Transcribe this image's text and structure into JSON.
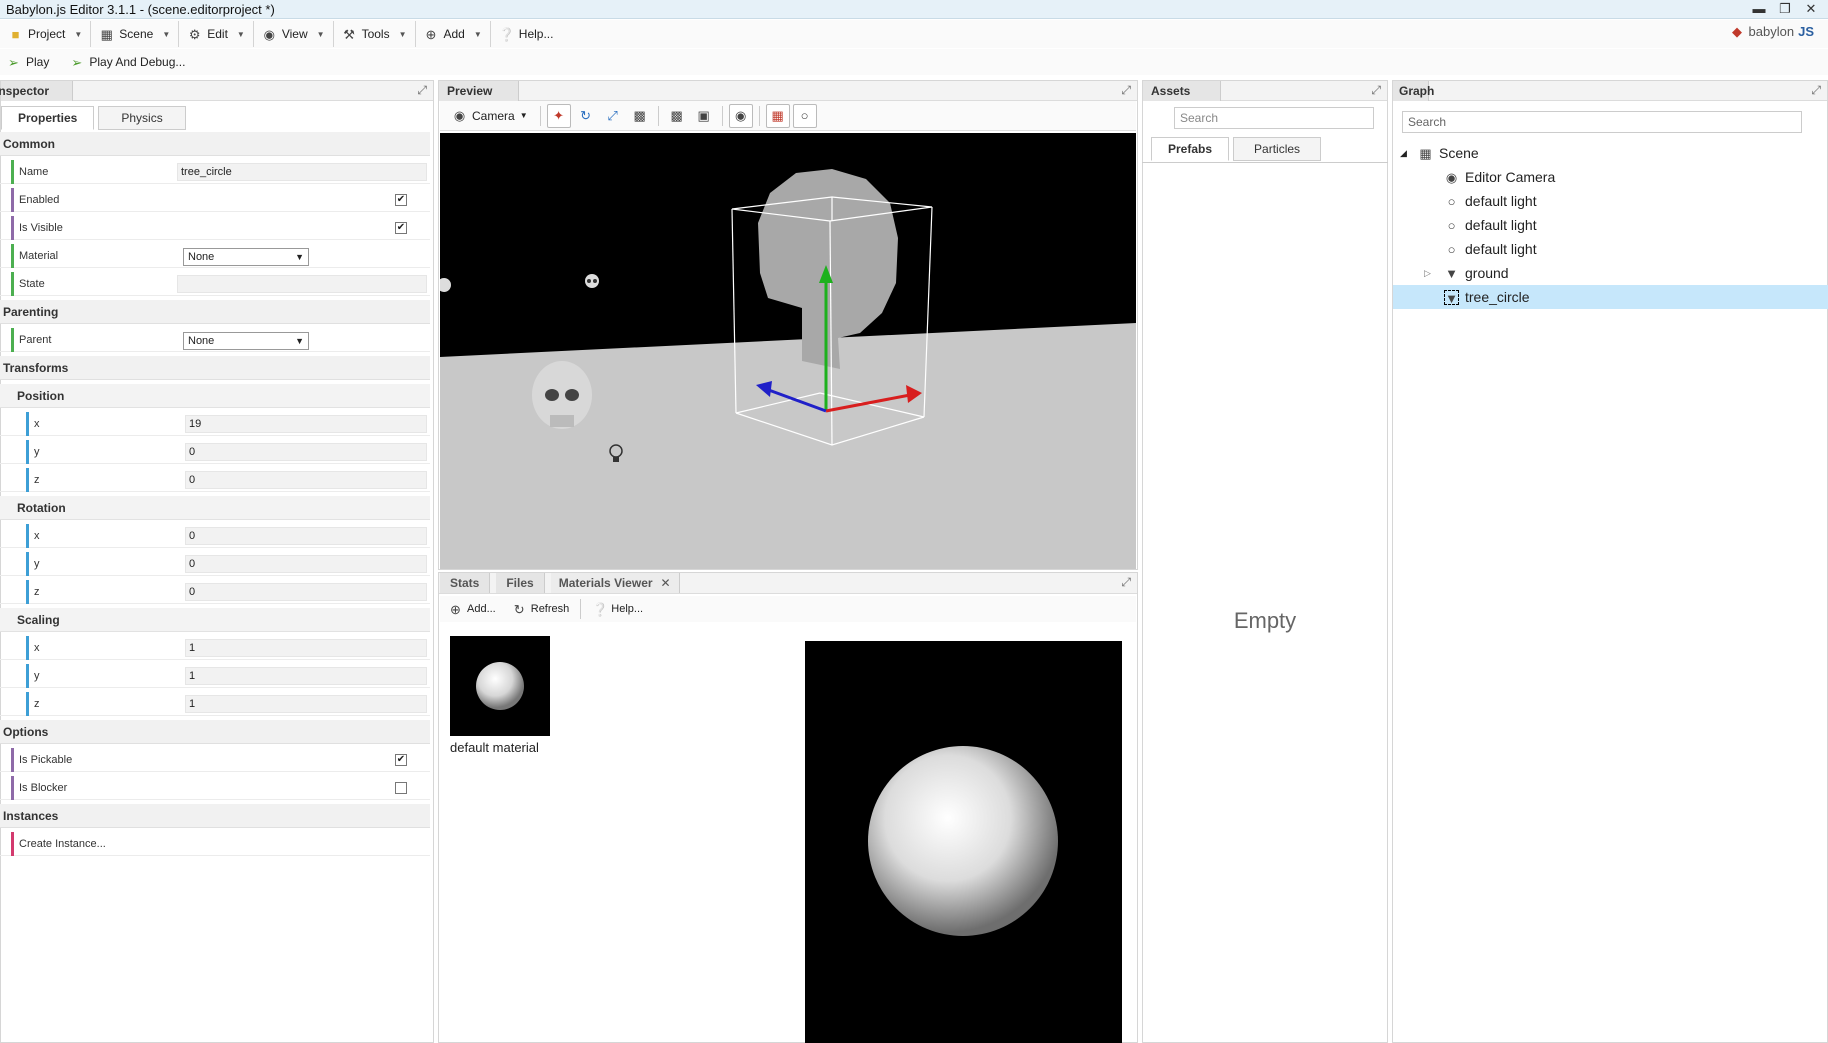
{
  "window": {
    "title": "Babylon.js Editor 3.1.1 - (scene.editorproject *)"
  },
  "menu": {
    "project": "Project",
    "scene": "Scene",
    "edit": "Edit",
    "view": "View",
    "tools": "Tools",
    "add": "Add",
    "help": "Help..."
  },
  "logo": {
    "prefix": "babylon",
    "suffix": "JS"
  },
  "playbar": {
    "play": "Play",
    "play_debug": "Play And Debug..."
  },
  "inspector": {
    "title": "Inspector",
    "tabs": [
      "Properties",
      "Physics"
    ],
    "sections": {
      "common": "Common",
      "parenting": "Parenting",
      "transforms": "Transforms",
      "position": "Position",
      "rotation": "Rotation",
      "scaling": "Scaling",
      "options": "Options",
      "instances": "Instances"
    },
    "labels": {
      "name": "Name",
      "enabled": "Enabled",
      "is_visible": "Is Visible",
      "material": "Material",
      "state": "State",
      "parent": "Parent",
      "x": "x",
      "y": "y",
      "z": "z",
      "is_pickable": "Is Pickable",
      "is_blocker": "Is Blocker",
      "create_instance": "Create Instance..."
    },
    "values": {
      "name": "tree_circle",
      "enabled": true,
      "is_visible": true,
      "material": "None",
      "state": "",
      "parent": "None",
      "position": [
        "19",
        "0",
        "0"
      ],
      "rotation": [
        "0",
        "0",
        "0"
      ],
      "scaling": [
        "1",
        "1",
        "1"
      ],
      "is_pickable": true,
      "is_blocker": false
    }
  },
  "preview": {
    "title": "Preview",
    "camera_label": "Camera"
  },
  "bottom": {
    "tabs": [
      "Stats",
      "Files",
      "Materials Viewer"
    ],
    "toolbar": {
      "add": "Add...",
      "refresh": "Refresh",
      "help": "Help..."
    },
    "material_name": "default material"
  },
  "assets": {
    "title": "Assets",
    "search_placeholder": "Search",
    "tabs": [
      "Prefabs",
      "Particles"
    ],
    "empty_text": "Empty"
  },
  "graph": {
    "title": "Graph",
    "search_placeholder": "Search",
    "nodes": [
      "Scene",
      "Editor Camera",
      "default light",
      "default light",
      "default light",
      "ground",
      "tree_circle"
    ],
    "selected": "tree_circle"
  },
  "colors": {
    "accent_selected": "#c6e7fb",
    "common_bar": "#4caf50",
    "transform_bar": "#3d9fd6",
    "instance_bar": "#d33a6e",
    "options_bar": "#8e6aa8"
  }
}
